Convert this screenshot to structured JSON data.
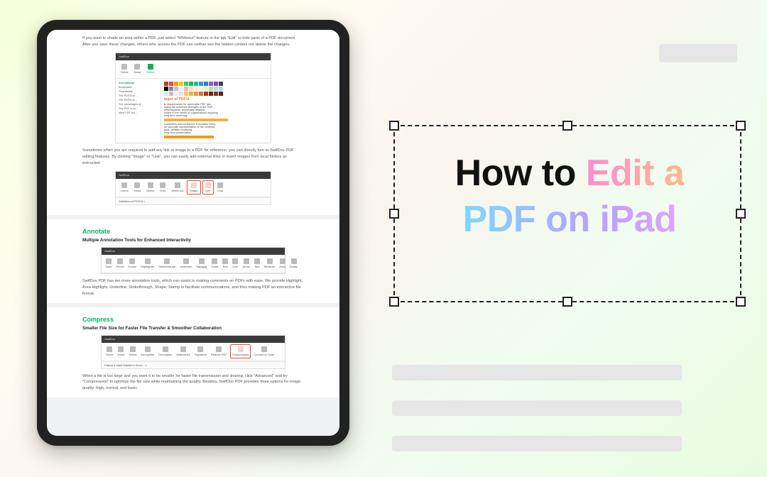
{
  "headline": {
    "part1": "How to ",
    "part2": "Edit a",
    "part3": "PDF on iPad"
  },
  "ipad": {
    "whiteout_para": "If you want to shade an area within a PDF, just select \"Whiteout\" feature in the tab \"Edit\" to hide parts of a PDF document. After you save these changes, others who access the PDF can neither see the hidden content nor delete the changes.",
    "inset1": {
      "title": "tages of PDF/A",
      "lines": "ts requirements for archivable PDF doc-\nsizing the universal strengths of the PDF\nunambiguous, technically detailed\nsuited to the needs of organizations requiring\nlong term archiving.",
      "tail": "completely self-contained. It includes every-\nfor accurate representation of the contents,\nguar- reliable rendering,\nlong-term preservation.",
      "left_labels": [
        "Annotations",
        "Bookmarks",
        "Thumbnails",
        "The PDF/A st...",
        "The PDF/A st...",
        "The advantages of...",
        "The PDF is oc...",
        "Most PDF aut..."
      ]
    },
    "link_para": "Sometimes when you are required to add any link or image to a PDF for reference, you can directly turn to SwifDoo PDF editing features. By clicking \"Image\" or \"Link\", you can easily add external links or insert images from local folders as instructed.",
    "inset2": {
      "tools": [
        "Home",
        "Hand",
        "Select",
        "Edit",
        "White-out",
        "Image",
        "Link",
        "Crop"
      ],
      "highlight": [
        "Image",
        "Link"
      ],
      "def": "Definition of PDF/A ×"
    },
    "annotate": {
      "heading": "Annotate",
      "sub": "Multiple Annotation Tools for Enhanced Interactivity",
      "tools": [
        "Note",
        "Pencil",
        "Eraser",
        "Highlighter",
        "Strikethrough",
        "Underline",
        "Squiggly",
        "Caret",
        "Box",
        "Line",
        "Arrow",
        "Tips",
        "Measure",
        "Area",
        "Stamp"
      ],
      "body": "SwifDoo PDF has ten more annotation tools, which can assist in making comments on PDFs with ease. We provide Highlight, Area Highlight, Underline, Strikethrough, Shape, Stamp to facilitate communications, and thus making PDF an interactive file format."
    },
    "compress": {
      "heading": "Compress",
      "sub": "Smaller File Size for Faster File Transfer & Smoother Collaboration",
      "tools": [
        "Home",
        "Hand",
        "Select",
        "Encryption",
        "Decryption",
        "Watermark",
        "Signature",
        "Reduce PDF",
        "Compression",
        "Convert to Scan"
      ],
      "highlight": [
        "Compression"
      ],
      "def": "Fallout 4 Vault Dweller's Survi...  ×",
      "body": "When a file is too large and you want it to be smaller for faster file transmission and sharing, click \"Advanced\" and try \"Compression\" to optimize the file size while maintaining the quality. Besides, SwifDoo PDF provides three options for image quality: high, normal, and basic."
    }
  },
  "colors": [
    "#c0392b",
    "#e74c3c",
    "#f39c12",
    "#f1c40f",
    "#2ecc71",
    "#27ae60",
    "#1abc9c",
    "#3498db",
    "#2980b9",
    "#9b59b6",
    "#8e44ad",
    "#34495e",
    "#000000",
    "#7f8c8d",
    "#bdc3c7",
    "#ecf0f1",
    "#f5b7b1",
    "#fadbd8",
    "#fdebd0",
    "#fcf3cf",
    "#d5f5e3",
    "#a9dfbf",
    "#a3e4d7",
    "#aed6f1",
    "#d6eaf8",
    "#d2b4de",
    "#f4ecf7",
    "#ebdef0",
    "#f8c471",
    "#f5b041",
    "#eb984e",
    "#dc7633",
    "#a04000",
    "#6e2c00",
    "#922b21",
    "#641e16"
  ]
}
